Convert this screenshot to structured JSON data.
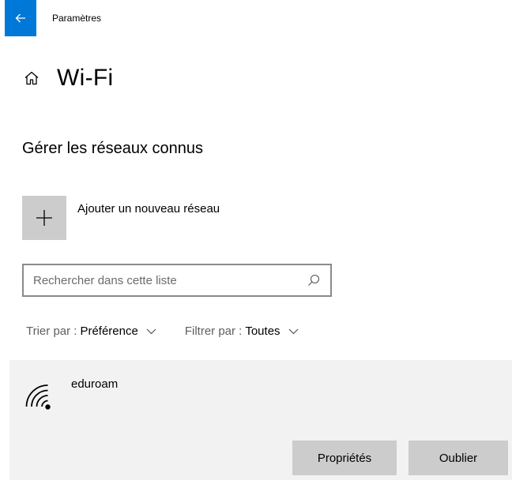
{
  "titlebar": {
    "app_title": "Paramètres",
    "back_icon": "arrow-left-icon",
    "accent_color": "#0078d7"
  },
  "header": {
    "home_icon": "home-icon",
    "title": "Wi-Fi"
  },
  "section": {
    "title": "Gérer les réseaux connus"
  },
  "add_network": {
    "icon": "plus-icon",
    "label": "Ajouter un nouveau réseau"
  },
  "search": {
    "placeholder": "Rechercher dans cette liste",
    "value": "",
    "icon": "search-icon"
  },
  "sort": {
    "label": "Trier par :",
    "value": "Préférence"
  },
  "filter": {
    "label": "Filtrer par :",
    "value": "Toutes"
  },
  "networks": [
    {
      "name": "eduroam",
      "icon": "wifi-icon",
      "buttons": {
        "properties": "Propriétés",
        "forget": "Oublier"
      }
    }
  ]
}
